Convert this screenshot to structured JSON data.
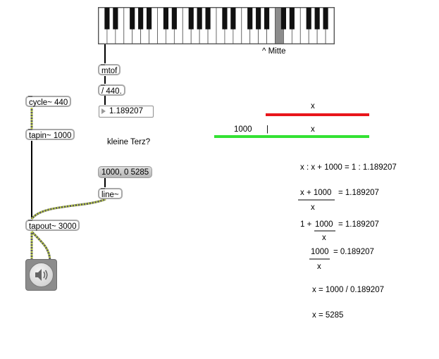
{
  "keyboard": {
    "white_keys": 28,
    "highlighted_white_key": 21,
    "mitte_label": "^ Mitte"
  },
  "objects": {
    "mtof": "mtof",
    "div440": "/ 440.",
    "number_value": "1.189207",
    "cycle": "cycle~ 440",
    "tapin": "tapin~ 1000",
    "tapout": "tapout~ 3000",
    "line": "line~",
    "message": "1000, 0 5285"
  },
  "comments": {
    "kleine_terz": "kleine Terz?",
    "red_x": "x",
    "green_1000": "1000",
    "green_bar": "|",
    "green_x": "x"
  },
  "equations": {
    "eq1": "x : x + 1000 = 1 : 1.189207",
    "eq2_num": "x + 1000",
    "eq2_rhs": "= 1.189207",
    "eq2_den": "x",
    "eq3_lhs": "1 +",
    "eq3_num": "1000",
    "eq3_rhs": "= 1.189207",
    "eq3_den": "x",
    "eq4_num": "1000",
    "eq4_rhs": "= 0.189207",
    "eq4_den": "x",
    "eq5": "x  = 1000 / 0.189207",
    "eq6": "x  = 5285"
  },
  "colors": {
    "red_line": "#e8161b",
    "green_line": "#33e233",
    "highlight_key": "#8c8c8c",
    "patch_cord_audio": "#b8c94a"
  },
  "speaker_icon": "speaker-icon"
}
